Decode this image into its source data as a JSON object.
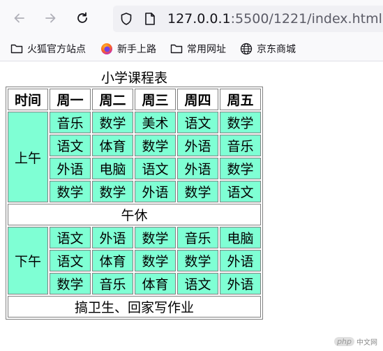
{
  "browser": {
    "url_host": "127.0.0.1",
    "url_rest": ":5500/1221/index.html",
    "bookmarks": [
      {
        "label": "火狐官方站点",
        "icon": "folder-icon"
      },
      {
        "label": "新手上路",
        "icon": "firefox-icon"
      },
      {
        "label": "常用网址",
        "icon": "folder-icon"
      },
      {
        "label": "京东商城",
        "icon": "globe-icon"
      }
    ]
  },
  "schedule": {
    "caption": "小学课程表",
    "headers": [
      "时间",
      "周一",
      "周二",
      "周三",
      "周四",
      "周五"
    ],
    "morning_label": "上午",
    "morning": [
      [
        "音乐",
        "数学",
        "美术",
        "语文",
        "数学"
      ],
      [
        "语文",
        "体育",
        "数学",
        "外语",
        "音乐"
      ],
      [
        "外语",
        "电脑",
        "语文",
        "外语",
        "数学"
      ],
      [
        "数学",
        "数学",
        "外语",
        "数学",
        "语文"
      ]
    ],
    "noon": "午休",
    "afternoon_label": "下午",
    "afternoon": [
      [
        "语文",
        "外语",
        "数学",
        "音乐",
        "电脑"
      ],
      [
        "语文",
        "体育",
        "数学",
        "数学",
        "外语"
      ],
      [
        "数学",
        "音乐",
        "体育",
        "语文",
        "外语"
      ]
    ],
    "footer": "搞卫生、回家写作业",
    "colors": {
      "cell_bg": "#7fffd4",
      "border": "#808080"
    }
  },
  "watermark": {
    "badge": "php",
    "text": "中文网"
  }
}
